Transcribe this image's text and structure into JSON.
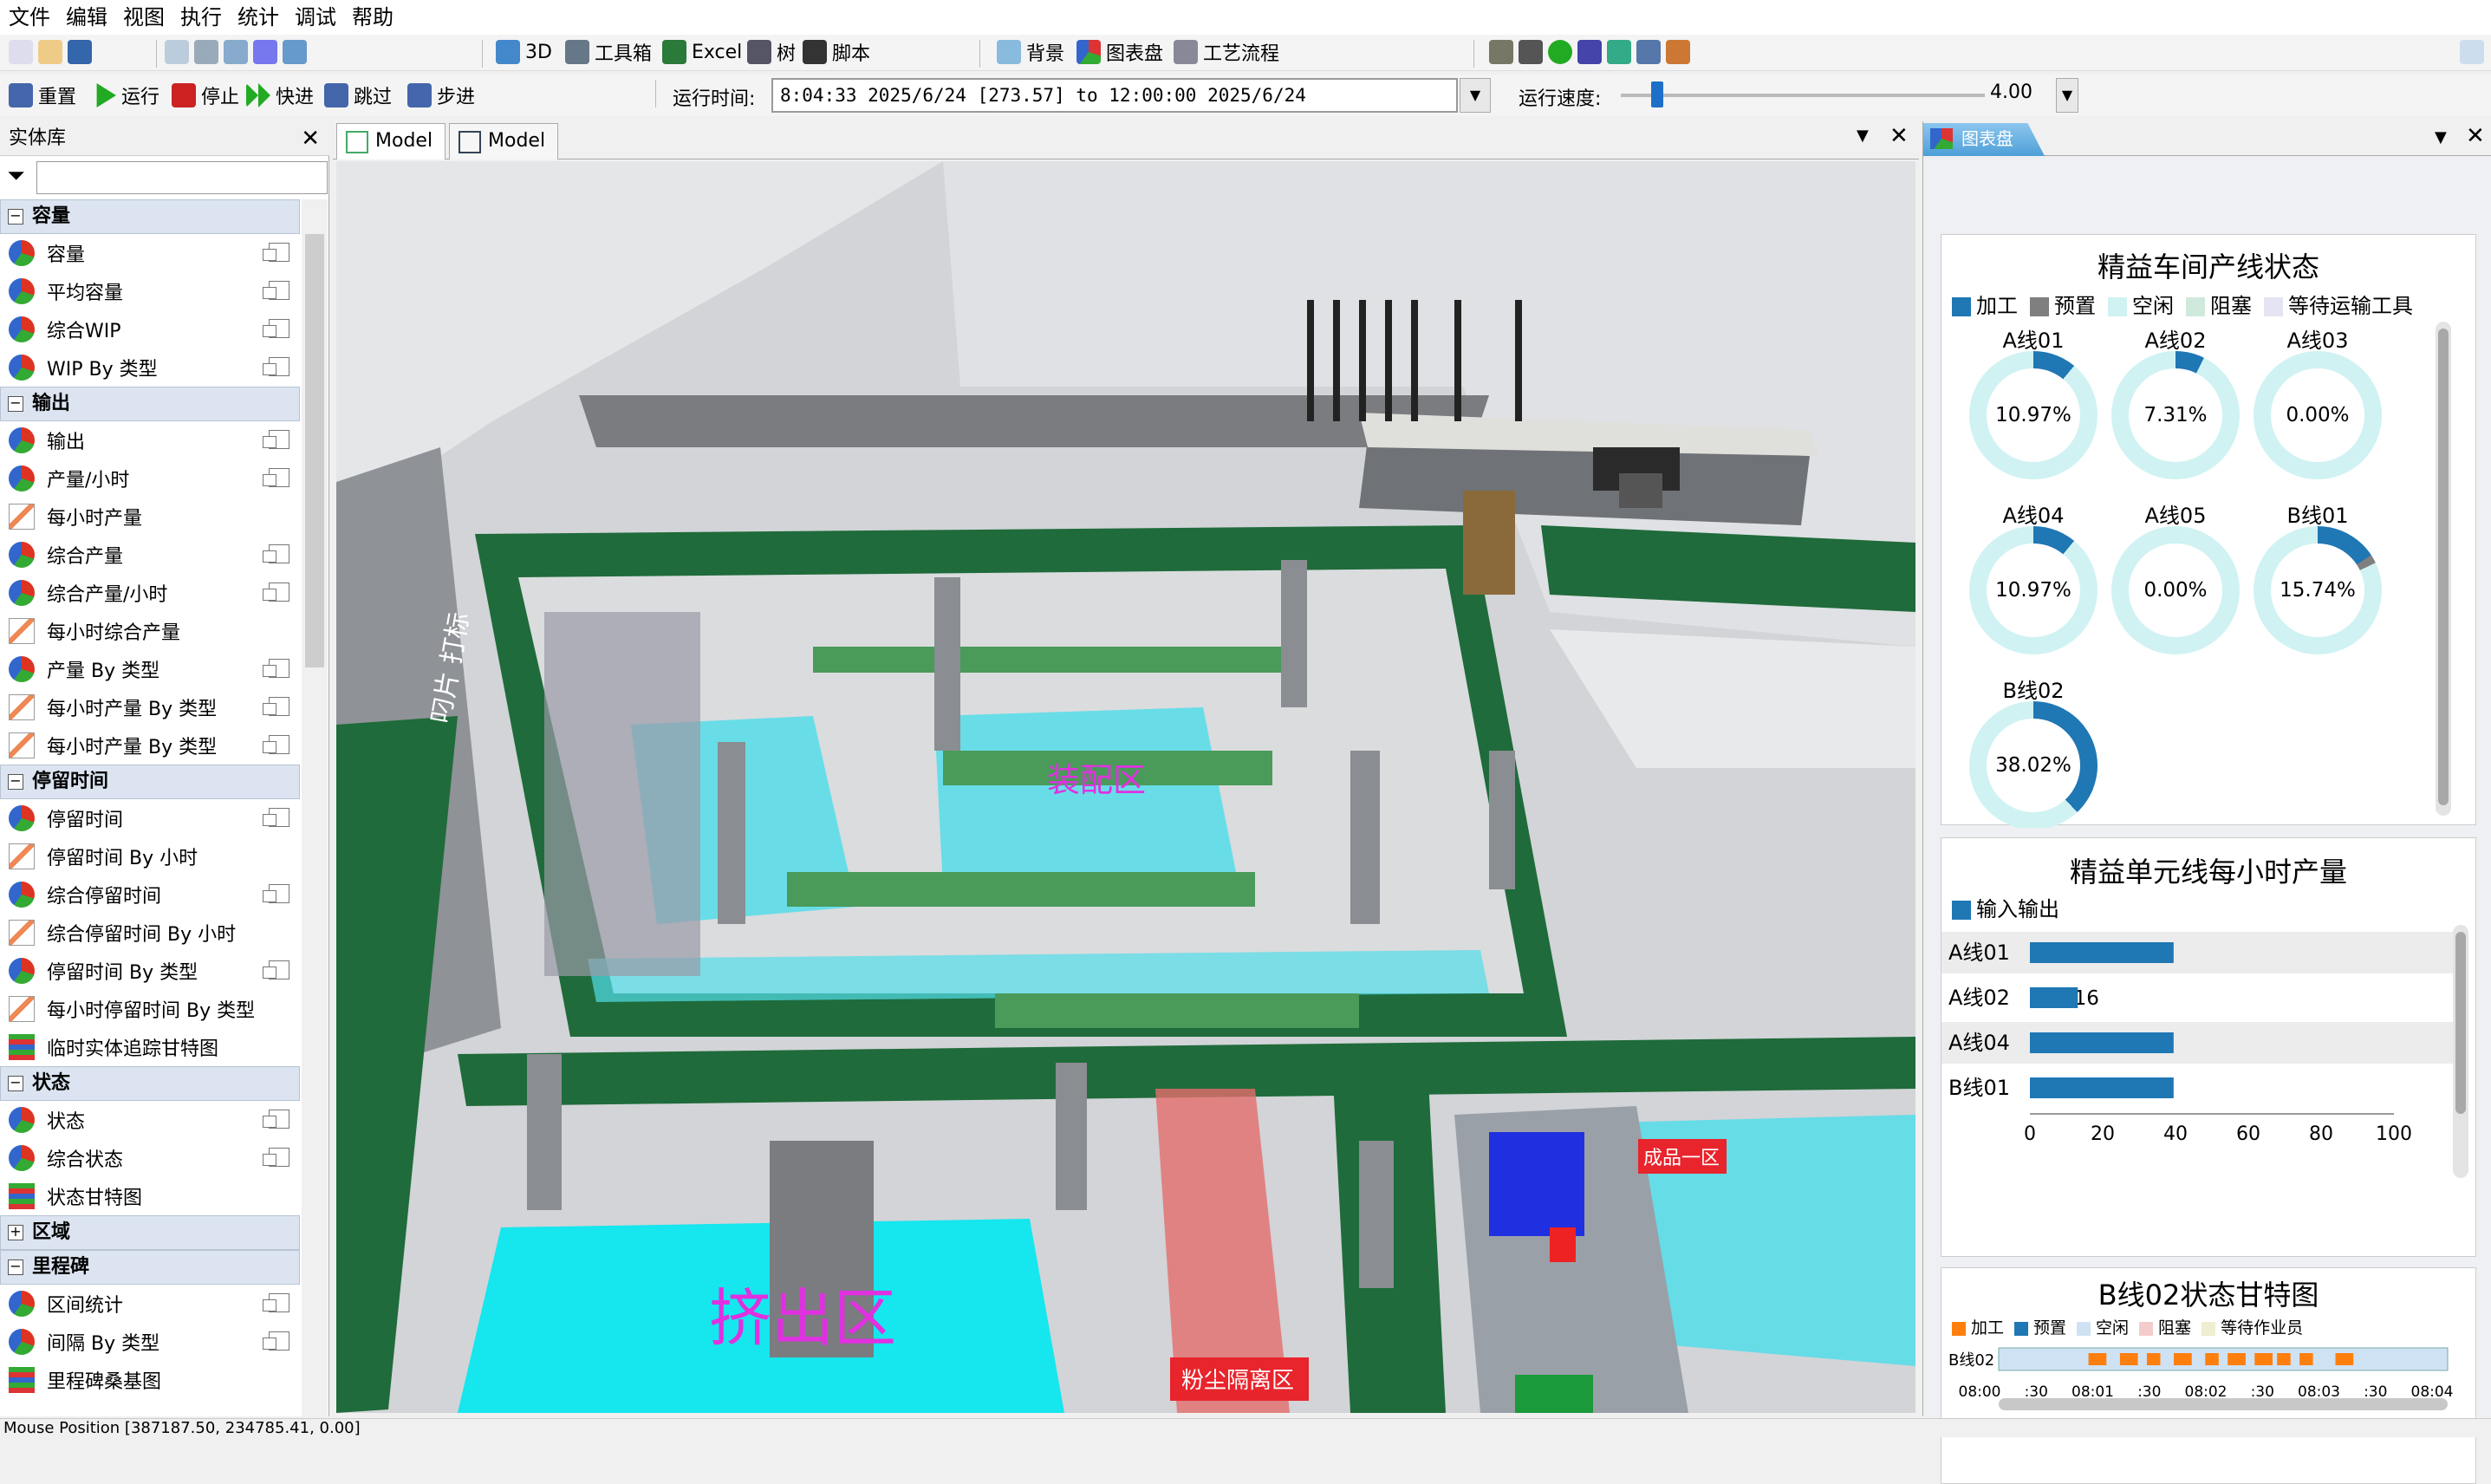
{
  "menu": [
    "文件",
    "编辑",
    "视图",
    "执行",
    "统计",
    "调试",
    "帮助"
  ],
  "toolbar1": {
    "b3d": "3D",
    "tools": "工具箱",
    "excel": "Excel",
    "tree": "树",
    "script": "脚本",
    "bg": "背景",
    "dash": "图表盘",
    "flow": "工艺流程"
  },
  "toolbar2": {
    "reset": "重置",
    "run": "运行",
    "stop": "停止",
    "fast": "快进",
    "skip": "跳过",
    "step": "步进",
    "runtime_label": "运行时间:",
    "runtime_value": "8:04:33  2025/6/24  [273.57]   to    12:00:00  2025/6/24",
    "speed_label": "运行速度:",
    "speed_value": "4.00",
    "speed_fraction": 0.1
  },
  "library": {
    "title": "实体库",
    "sections": [
      {
        "name": "容量",
        "items": [
          [
            "容量",
            "c",
            1
          ],
          [
            "平均容量",
            "c",
            1
          ],
          [
            "综合WIP",
            "c",
            1
          ],
          [
            "WIP By 类型",
            "c",
            1
          ]
        ]
      },
      {
        "name": "输出",
        "items": [
          [
            "输出",
            "c",
            1
          ],
          [
            "产量/小时",
            "c",
            1
          ],
          [
            "每小时产量",
            "g",
            0
          ],
          [
            "综合产量",
            "c",
            1
          ],
          [
            "综合产量/小时",
            "c",
            1
          ],
          [
            "每小时综合产量",
            "g",
            0
          ],
          [
            "产量 By 类型",
            "c",
            1
          ],
          [
            "每小时产量 By 类型",
            "g",
            1
          ],
          [
            "每小时产量 By 类型",
            "g",
            1
          ]
        ]
      },
      {
        "name": "停留时间",
        "items": [
          [
            "停留时间",
            "c",
            1
          ],
          [
            "停留时间 By 小时",
            "g",
            0
          ],
          [
            "综合停留时间",
            "c",
            1
          ],
          [
            "综合停留时间 By 小时",
            "g",
            0
          ],
          [
            "停留时间 By 类型",
            "c",
            1
          ],
          [
            "每小时停留时间 By 类型",
            "g",
            0
          ],
          [
            "临时实体追踪甘特图",
            "t",
            0
          ]
        ]
      },
      {
        "name": "状态",
        "items": [
          [
            "状态",
            "c",
            1
          ],
          [
            "综合状态",
            "c",
            1
          ],
          [
            "状态甘特图",
            "t",
            0
          ]
        ]
      },
      {
        "name": "区域",
        "collapsed": true,
        "items": []
      },
      {
        "name": "里程碑",
        "items": [
          [
            "区间统计",
            "c",
            1
          ],
          [
            "间隔 By 类型",
            "c",
            1
          ],
          [
            "里程碑桑基图",
            "t",
            0
          ]
        ]
      }
    ]
  },
  "tabs": [
    "Model",
    "Model"
  ],
  "scene": {
    "assembly": "装配区",
    "extrusion": "挤出区",
    "dust": "粉尘隔离区",
    "kitting": "成品一区",
    "left_wall": "叼片 打标"
  },
  "dashboard": {
    "tab": "图表盘",
    "status": {
      "title": "精益车间产线状态",
      "legend": [
        [
          "加工",
          "#1f77b4"
        ],
        [
          "预置",
          "#7f7f7f"
        ],
        [
          "空闲",
          "#d0f2f2"
        ],
        [
          "阻塞",
          "#cfe9dd"
        ],
        [
          "等待运输工具",
          "#e4e4f2"
        ]
      ],
      "lines": [
        {
          "name": "A线01",
          "value": 10.97
        },
        {
          "name": "A线02",
          "value": 7.31
        },
        {
          "name": "A线03",
          "value": 0.0
        },
        {
          "name": "A线04",
          "value": 10.97
        },
        {
          "name": "A线05",
          "value": 0.0
        },
        {
          "name": "B线01",
          "value": 15.74
        },
        {
          "name": "B线02",
          "value": 38.02
        }
      ],
      "labels": [
        "10.97%",
        "7.31%",
        "0.00%",
        "10.97%",
        "0.00%",
        "15.74%",
        "38.02%"
      ]
    },
    "hourly": {
      "title": "精益单元线每小时产量",
      "legend": "输入输出",
      "rows": [
        {
          "name": "A线01",
          "value": 39.48
        },
        {
          "name": "A线02",
          "value": 13.16
        },
        {
          "name": "A线04",
          "value": 39.48
        },
        {
          "name": "B线01",
          "value": 39.48
        }
      ],
      "values_text": [
        "39.48",
        "13.16",
        "39.48",
        "39.48"
      ],
      "ticks": [
        "0",
        "20",
        "40",
        "60",
        "80",
        "100"
      ],
      "max": 100
    },
    "gantt": {
      "title": "B线02状态甘特图",
      "legend": [
        [
          "加工",
          "#ff7f0e"
        ],
        [
          "预置",
          "#1f77b4"
        ],
        [
          "空闲",
          "#cfe2f3"
        ],
        [
          "阻塞",
          "#f4cccc"
        ],
        [
          "等待作业员",
          "#eeeed0"
        ]
      ],
      "row": "B线02",
      "ticks": [
        "08:00",
        ":30",
        "08:01",
        ":30",
        "08:02",
        ":30",
        "08:03",
        ":30",
        "08:04"
      ],
      "blocks": [
        [
          0.2,
          0.24
        ],
        [
          0.27,
          0.31
        ],
        [
          0.33,
          0.36
        ],
        [
          0.39,
          0.43
        ],
        [
          0.46,
          0.49
        ],
        [
          0.51,
          0.55
        ],
        [
          0.57,
          0.61
        ],
        [
          0.62,
          0.65
        ],
        [
          0.67,
          0.7
        ],
        [
          0.75,
          0.79
        ]
      ]
    }
  },
  "status_bar": "Mouse Position [387187.50, 234785.41, 0.00]"
}
